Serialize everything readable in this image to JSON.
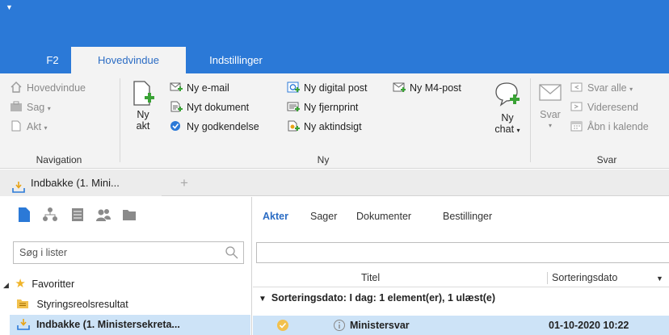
{
  "ribbon_tabs": [
    "F2",
    "Hovedvindue",
    "Indstillinger"
  ],
  "ribbon": {
    "navigation": {
      "label": "Navigation",
      "items": [
        "Hovedvindue",
        "Sag",
        "Akt"
      ]
    },
    "ny": {
      "label": "Ny",
      "big_akt": [
        "Ny",
        "akt"
      ],
      "col1": [
        "Ny e-mail",
        "Nyt dokument",
        "Ny godkendelse"
      ],
      "col2": [
        "Ny digital post",
        "Ny fjernprint",
        "Ny aktindsigt"
      ],
      "col3": [
        "Ny M4-post"
      ],
      "big_chat": [
        "Ny",
        "chat"
      ]
    },
    "svar": {
      "label": "Svar",
      "big_svar": "Svar",
      "items": [
        "Svar alle",
        "Videresend",
        "Åbn i kalende"
      ]
    }
  },
  "doc_tab": {
    "label": "Indbakke (1. Mini...",
    "add": "+"
  },
  "left": {
    "search_placeholder": "Søg i lister",
    "tree": [
      "Favoritter",
      "Styringsreolsresultat",
      "Indbakke (1. Ministersekreta..."
    ]
  },
  "right": {
    "view_tabs": [
      "Akter",
      "Sager",
      "Dokumenter",
      "Bestillinger"
    ],
    "columns": [
      "Titel",
      "Sorteringsdato"
    ],
    "group_row": "Sorteringsdato: I dag: 1 element(er), 1 ulæst(e)",
    "item": {
      "title": "Ministersvar",
      "date": "01-10-2020 10:22"
    }
  },
  "colors": {
    "brand_blue": "#2b79d7",
    "selection": "#cde3f7",
    "ribbon_bg": "#f3f3f3"
  }
}
